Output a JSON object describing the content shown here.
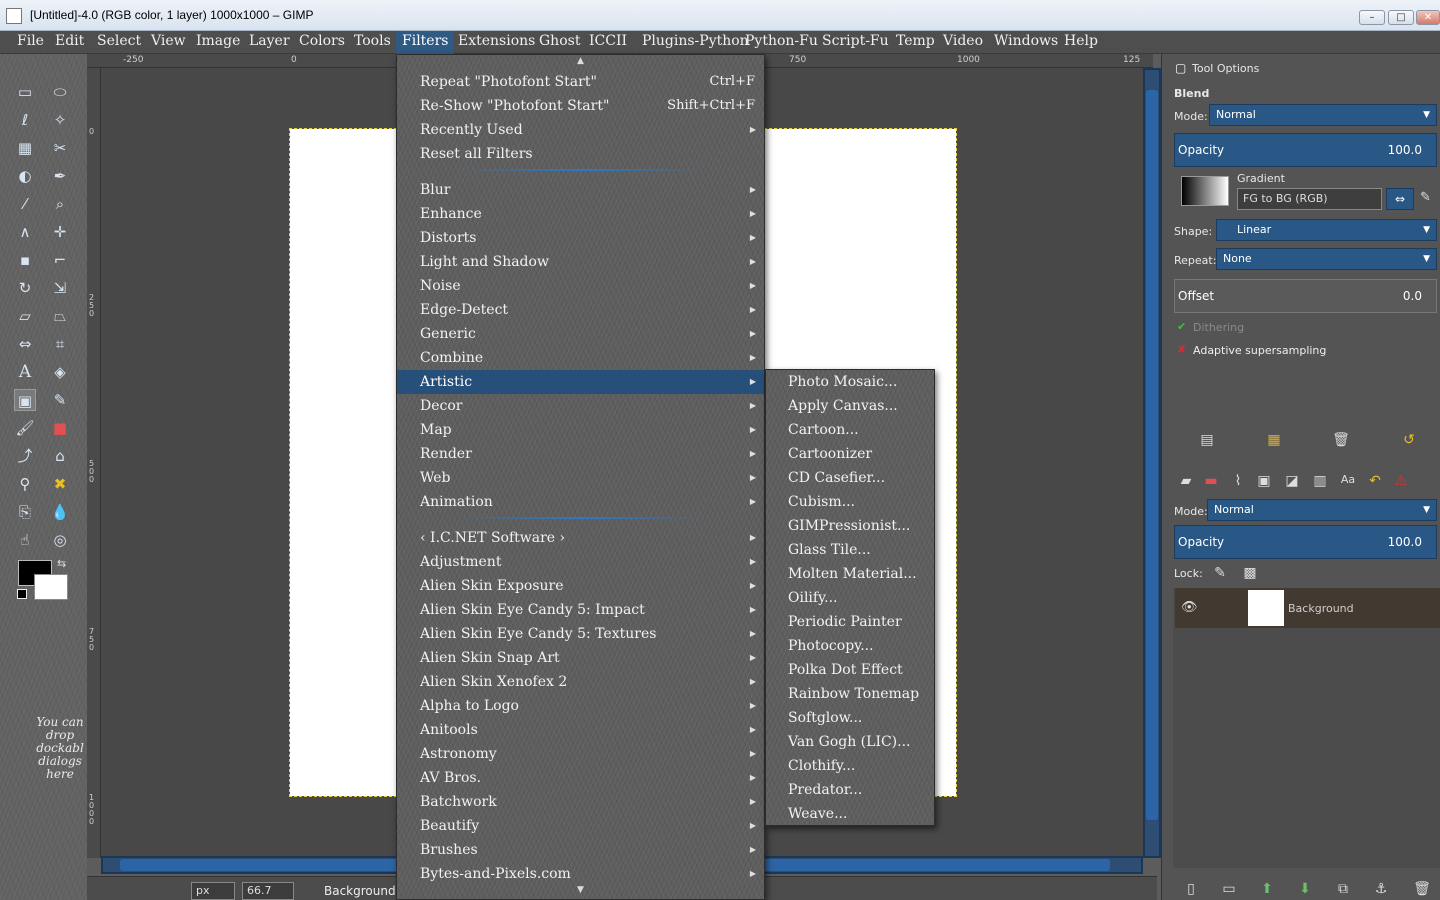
{
  "window": {
    "title": "[Untitled]-4.0 (RGB color, 1 layer) 1000x1000 – GIMP",
    "controls": [
      "–",
      "□",
      "✕"
    ]
  },
  "menubar": {
    "items": [
      "File",
      "Edit",
      "Select",
      "View",
      "Image",
      "Layer",
      "Colors",
      "Tools",
      "Filters",
      "Extensions",
      "Ghost",
      "ICCII",
      "Plugins-Python",
      "Python-Fu",
      "Script-Fu",
      "Temp",
      "Video",
      "Windows",
      "Help"
    ],
    "active": "Filters"
  },
  "filters_menu": {
    "top_items": [
      {
        "label": "Repeat \"Photofont Start\"",
        "shortcut": "Ctrl+F"
      },
      {
        "label": "Re-Show \"Photofont Start\"",
        "shortcut": "Shift+Ctrl+F"
      },
      {
        "label": "Recently Used",
        "submenu": true
      },
      {
        "label": "Reset all Filters"
      }
    ],
    "group2": [
      "Blur",
      "Enhance",
      "Distorts",
      "Light and Shadow",
      "Noise",
      "Edge-Detect",
      "Generic",
      "Combine",
      "Artistic",
      "Decor",
      "Map",
      "Render",
      "Web",
      "Animation"
    ],
    "group3": [
      "‹ I.C.NET Software ›",
      "Adjustment",
      "Alien Skin Exposure",
      "Alien Skin Eye Candy 5: Impact",
      "Alien Skin Eye Candy 5: Textures",
      "Alien Skin Snap Art",
      "Alien Skin Xenofex 2",
      "Alpha to Logo",
      "Anitools",
      "Astronomy",
      "AV Bros.",
      "Batchwork",
      "Beautify",
      "Brushes",
      "Bytes-and-Pixels.com"
    ],
    "highlighted": "Artistic"
  },
  "artistic_submenu": {
    "items": [
      "Photo Mosaic...",
      "Apply Canvas...",
      "Cartoon...",
      "Cartoonizer",
      "CD Casefier...",
      "Cubism...",
      "GIMPressionist...",
      "Glass Tile...",
      "Molten Material...",
      "Oilify...",
      "Periodic Painter",
      "Photocopy...",
      "Polka Dot Effect",
      "Rainbow Tonemap",
      "Softglow...",
      "Van Gogh (LIC)...",
      "Clothify...",
      "Predator...",
      "Weave..."
    ]
  },
  "toolbox": {
    "dock_hint": "You can drop dockabl dialogs here",
    "fg_color": "#000000",
    "bg_color": "#ffffff"
  },
  "rulers": {
    "top_ticks": [
      "-250",
      "0",
      "750",
      "1000",
      "125"
    ],
    "left_ticks": [
      "0",
      "250",
      "500",
      "750",
      "1000"
    ]
  },
  "statusbar": {
    "unit": "px",
    "zoom": "66.7",
    "layer": "Background"
  },
  "tool_options": {
    "title": "Tool Options",
    "tool_name": "Blend",
    "mode_label": "Mode:",
    "mode_value": "Normal",
    "opacity_label": "Opacity",
    "opacity_value": "100.0",
    "gradient_label": "Gradient",
    "gradient_value": "FG to BG (RGB)",
    "shape_label": "Shape:",
    "shape_value": "Linear",
    "repeat_label": "Repeat:",
    "repeat_value": "None",
    "offset_label": "Offset",
    "offset_value": "0.0",
    "dithering_label": "Dithering",
    "adaptive_label": "Adaptive supersampling"
  },
  "layers": {
    "mode_label": "Mode:",
    "mode_value": "Normal",
    "opacity_label": "Opacity",
    "opacity_value": "100.0",
    "lock_label": "Lock:",
    "layer_name": "Background"
  },
  "colors": {
    "accent": "#2a5886",
    "highlight": "#26507a",
    "menu_bg": "#5e5e5e",
    "scrollbar": "#2b65a6"
  }
}
